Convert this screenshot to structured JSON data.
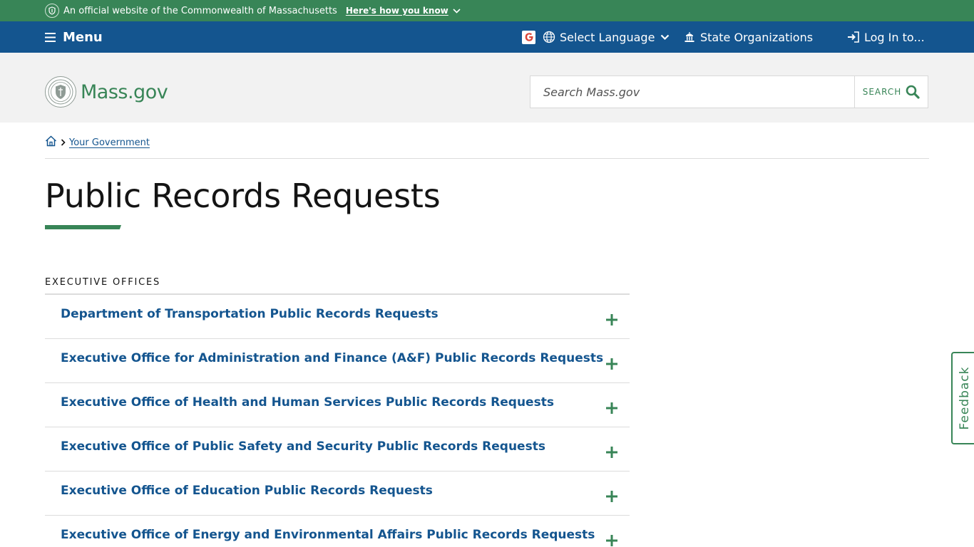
{
  "banner": {
    "text": "An official website of the Commonwealth of Massachusetts",
    "how_you_know": "Here's how you know"
  },
  "nav": {
    "menu_label": "Menu",
    "language_label": "Select Language",
    "state_orgs_label": "State Organizations",
    "login_label": "Log In to..."
  },
  "header": {
    "logo_text": "Mass.gov",
    "search_placeholder": "Search Mass.gov",
    "search_button": "SEARCH"
  },
  "breadcrumb": {
    "items": [
      "Your Government"
    ]
  },
  "page": {
    "title": "Public Records Requests",
    "section_label": "EXECUTIVE OFFICES"
  },
  "accordion": [
    {
      "title": "Department of Transportation Public Records Requests"
    },
    {
      "title": "Executive Office for Administration and Finance (A&F) Public Records Requests"
    },
    {
      "title": "Executive Office of Health and Human Services Public Records Requests"
    },
    {
      "title": "Executive Office of Public Safety and Security Public Records Requests"
    },
    {
      "title": "Executive Office of Education Public Records Requests"
    },
    {
      "title": "Executive Office of Energy and Environmental Affairs Public Records Requests"
    }
  ],
  "feedback": {
    "label": "Feedback"
  },
  "colors": {
    "green": "#388557",
    "blue": "#14558f",
    "header_bg": "#f2f2f2"
  },
  "icons": {
    "seal": "massachusetts-seal-icon",
    "menu": "hamburger-icon",
    "google": "google-translate-icon",
    "globe": "globe-icon",
    "chevron": "chevron-down-icon",
    "building": "state-building-icon",
    "login": "login-icon",
    "search": "search-icon",
    "home": "home-icon",
    "plus": "plus-icon"
  }
}
